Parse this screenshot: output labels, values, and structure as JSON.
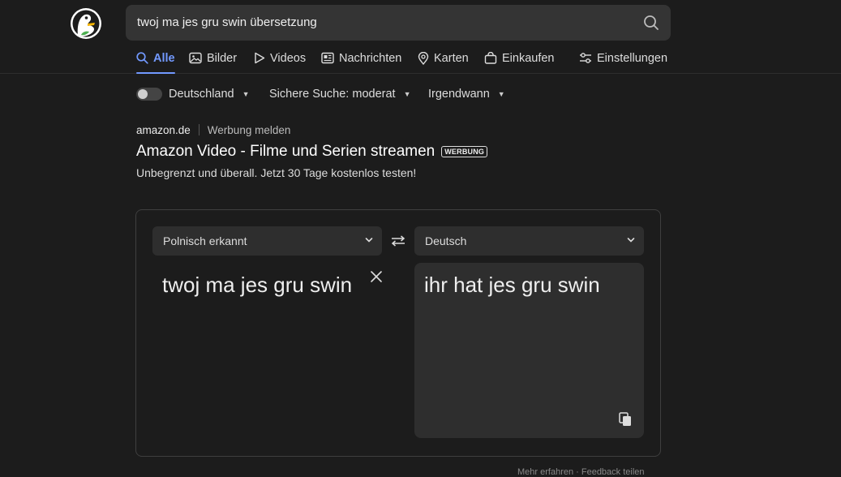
{
  "search": {
    "query": "twoj ma jes gru swin übersetzung"
  },
  "tabs": [
    {
      "label": "Alle",
      "icon": "search-icon",
      "active": true
    },
    {
      "label": "Bilder",
      "icon": "image-icon",
      "active": false
    },
    {
      "label": "Videos",
      "icon": "play-icon",
      "active": false
    },
    {
      "label": "Nachrichten",
      "icon": "newspaper-icon",
      "active": false
    },
    {
      "label": "Karten",
      "icon": "map-pin-icon",
      "active": false
    },
    {
      "label": "Einkaufen",
      "icon": "shopping-bag-icon",
      "active": false
    },
    {
      "label": "Einstellungen",
      "icon": "sliders-icon",
      "active": false
    }
  ],
  "filters": {
    "region": "Deutschland",
    "safe_search": "Sichere Suche: moderat",
    "time": "Irgendwann"
  },
  "ad": {
    "source": "amazon.de",
    "report": "Werbung melden",
    "title": "Amazon Video - Filme und Serien streamen",
    "badge": "WERBUNG",
    "description": "Unbegrenzt und überall. Jetzt 30 Tage kostenlos testen!"
  },
  "translator": {
    "source_lang": "Polnisch erkannt",
    "target_lang": "Deutsch",
    "source_text": "twoj ma jes gru swin",
    "target_text": "ihr hat jes gru swin"
  },
  "footer": {
    "note": "Mehr erfahren · Feedback teilen"
  },
  "colors": {
    "background": "#1c1c1c",
    "accent": "#7299ff",
    "panel": "#2e2e2e"
  }
}
